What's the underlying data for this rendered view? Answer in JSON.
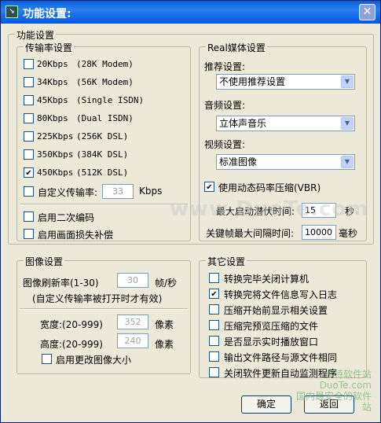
{
  "window": {
    "title": "功能设置:",
    "close_glyph": "✕",
    "app_icon_glyph": "↘"
  },
  "main_group": {
    "title": "功能设置"
  },
  "bitrate": {
    "title": "传输率设置",
    "items": [
      {
        "rate": "20Kbps",
        "desc": "(28K Modem)",
        "checked": false
      },
      {
        "rate": "34Kbps",
        "desc": "(56K Modem)",
        "checked": false
      },
      {
        "rate": "45Kbps",
        "desc": "(Single ISDN)",
        "checked": false
      },
      {
        "rate": "80Kbps",
        "desc": "(Dual ISDN)",
        "checked": false
      },
      {
        "rate": "225Kbps",
        "desc": "(256K DSL)",
        "checked": false
      },
      {
        "rate": "350Kbps",
        "desc": "(384K DSL)",
        "checked": false
      },
      {
        "rate": "450Kbps",
        "desc": "(512K DSL)",
        "checked": true
      }
    ],
    "custom_label": "自定义传输率:",
    "custom_value": "33",
    "custom_unit": "Kbps",
    "secondary_encoding": "启用二次编码",
    "frame_loss": "启用画面损失补偿"
  },
  "real": {
    "title": "Real媒体设置",
    "recommend_label": "推荐设置:",
    "recommend_value": "不使用推荐设置",
    "audio_label": "音频设置:",
    "audio_value": "立体声音乐",
    "video_label": "视频设置:",
    "video_value": "标准图像",
    "vbr_label": "使用动态码率压缩(VBR)",
    "latency_label": "最大启动潜伏时间:",
    "latency_value": "15",
    "latency_unit": "秒",
    "keyframe_label": "关键帧最大间隔时间:",
    "keyframe_value": "10000",
    "keyframe_unit": "毫秒"
  },
  "image": {
    "title": "图像设置",
    "refresh_label": "图像刷新率(1-30)",
    "refresh_value": "30",
    "refresh_unit": "帧/秒",
    "refresh_note": "(自定义传输率被打开时才有效)",
    "width_label": "宽度:(20-999)",
    "width_value": "352",
    "width_unit": "像素",
    "height_label": "高度:(20-999)",
    "height_value": "240",
    "height_unit": "像素",
    "resize_label": "启用更改图像大小"
  },
  "other": {
    "title": "其它设置",
    "items": [
      {
        "label": "转换完毕关闭计算机",
        "checked": false
      },
      {
        "label": "转换完将文件信息写入日志",
        "checked": true
      },
      {
        "label": "压缩开始前显示相关设置",
        "checked": false
      },
      {
        "label": "压缩完预览压缩的文件",
        "checked": false
      },
      {
        "label": "是否显示实时播放窗口",
        "checked": false
      },
      {
        "label": "输出文件路径与源文件相同",
        "checked": false
      },
      {
        "label": "关闭软件更新自动监测程序",
        "checked": false
      }
    ]
  },
  "buttons": {
    "ok": "确定",
    "back": "返回"
  },
  "watermarks": {
    "center": "www.DuoTe.com",
    "corner_line1": "多特软件站",
    "corner_line2": "DuoTe.com",
    "corner_line3": "国内最安全的软件站"
  }
}
